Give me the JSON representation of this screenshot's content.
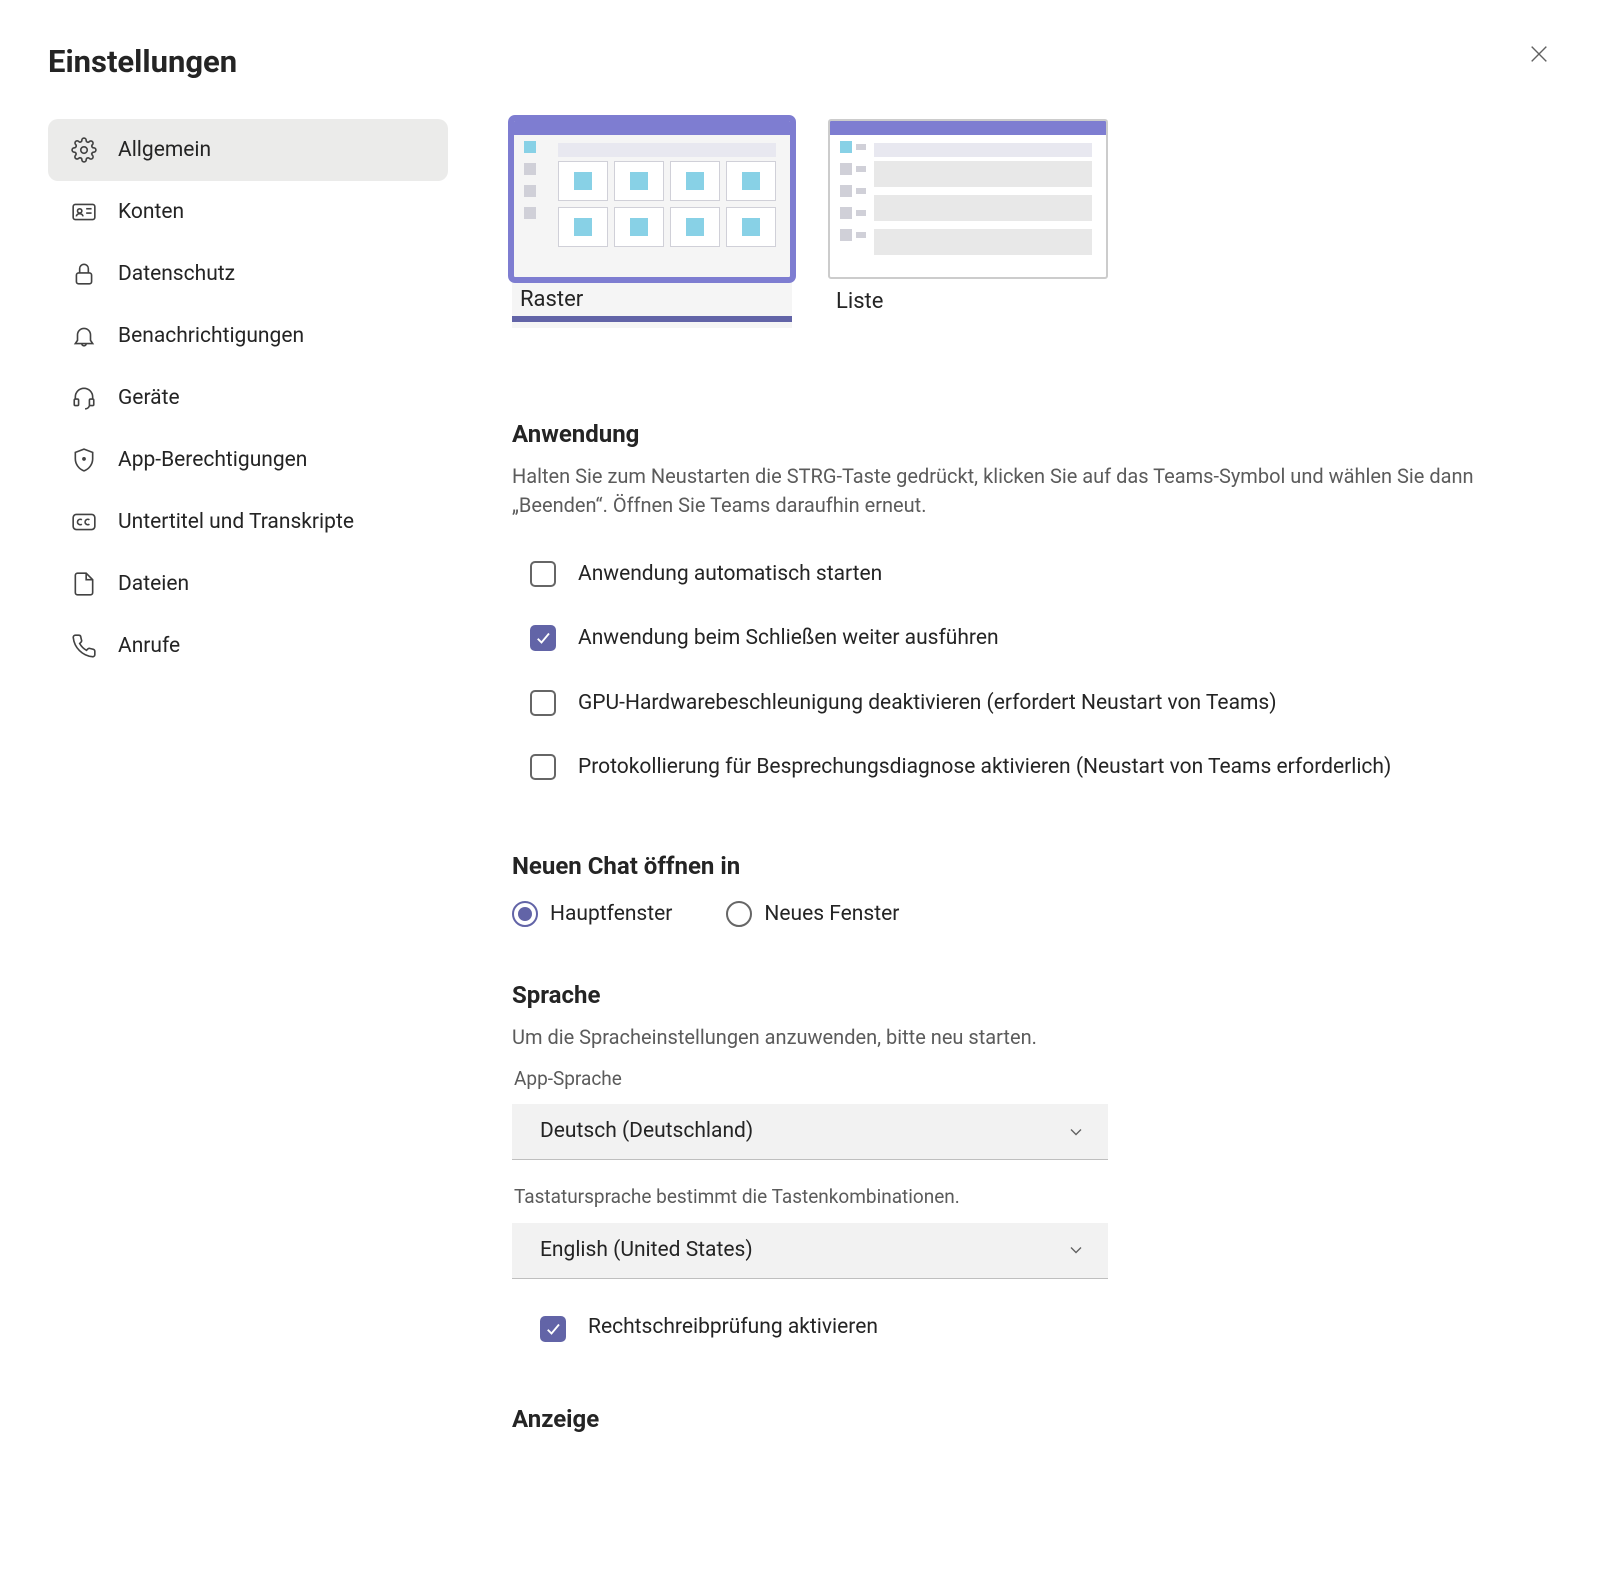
{
  "header": {
    "title": "Einstellungen"
  },
  "colors": {
    "accent": "#6264A7"
  },
  "sidebar": {
    "items": [
      {
        "label": "Allgemein",
        "icon": "gear-icon",
        "selected": true
      },
      {
        "label": "Konten",
        "icon": "id-card-icon",
        "selected": false
      },
      {
        "label": "Datenschutz",
        "icon": "lock-icon",
        "selected": false
      },
      {
        "label": "Benachrichtigungen",
        "icon": "bell-icon",
        "selected": false
      },
      {
        "label": "Geräte",
        "icon": "headset-icon",
        "selected": false
      },
      {
        "label": "App-Berechtigungen",
        "icon": "shield-icon",
        "selected": false
      },
      {
        "label": "Untertitel und Transkripte",
        "icon": "cc-icon",
        "selected": false
      },
      {
        "label": "Dateien",
        "icon": "file-icon",
        "selected": false
      },
      {
        "label": "Anrufe",
        "icon": "phone-icon",
        "selected": false
      }
    ]
  },
  "layout": {
    "options": [
      {
        "label": "Raster",
        "selected": true
      },
      {
        "label": "Liste",
        "selected": false
      }
    ]
  },
  "application": {
    "title": "Anwendung",
    "description": "Halten Sie zum Neustarten die STRG-Taste gedrückt, klicken Sie auf das Teams-Symbol und wählen Sie dann „Beenden“. Öffnen Sie Teams daraufhin erneut.",
    "options": [
      {
        "label": "Anwendung automatisch starten",
        "checked": false
      },
      {
        "label": "Anwendung beim Schließen weiter ausführen",
        "checked": true
      },
      {
        "label": "GPU-Hardwarebeschleunigung deaktivieren (erfordert Neustart von Teams)",
        "checked": false
      },
      {
        "label": "Protokollierung für Besprechungsdiagnose aktivieren (Neustart von Teams erforderlich)",
        "checked": false
      }
    ]
  },
  "chat": {
    "title": "Neuen Chat öffnen in",
    "options": [
      {
        "label": "Hauptfenster",
        "checked": true
      },
      {
        "label": "Neues Fenster",
        "checked": false
      }
    ]
  },
  "language": {
    "title": "Sprache",
    "description": "Um die Spracheinstellungen anzuwenden, bitte neu starten.",
    "app_language_label": "App-Sprache",
    "app_language_value": "Deutsch (Deutschland)",
    "keyboard_label": "Tastatursprache bestimmt die Tastenkombinationen.",
    "keyboard_value": "English (United States)",
    "spellcheck": {
      "label": "Rechtschreibprüfung aktivieren",
      "checked": true
    }
  },
  "display": {
    "title": "Anzeige"
  }
}
